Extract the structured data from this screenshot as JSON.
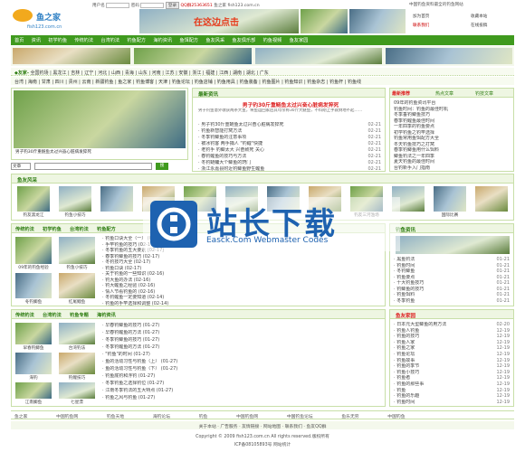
{
  "top": {
    "site_label": "鱼之家",
    "user_label": "用户名",
    "pass_label": "密码",
    "login_btn": "登录",
    "register": "注册",
    "forgot": "忘记密码",
    "site_url": "鱼之家 fish123.com.cn",
    "qq": "QQ群25363651",
    "slogan": "中国钓鱼资料最全的钓鱼网站",
    "links": [
      "加为首页",
      "收藏本站",
      "联系我们",
      "在线投稿"
    ]
  },
  "logo": {
    "cn": "鱼之家",
    "url": "fish123.com.cn"
  },
  "banner": {
    "text": "在这边点击"
  },
  "nav": {
    "items": [
      "首页",
      "资讯",
      "初学钓鱼",
      "传统钓法",
      "台湾钓法",
      "钓鱼配方",
      "海钓资讯",
      "鱼饵配方",
      "鱼友风采",
      "鱼友俱乐部",
      "钓鱼视频",
      "鱼友家园"
    ]
  },
  "region_rows": [
    {
      "label": "◆友家-",
      "items": [
        "全国钓场",
        "黑龙江",
        "吉林",
        "辽宁",
        "河北",
        "山西",
        "青海",
        "山东",
        "河南",
        "江苏",
        "安徽",
        "浙江",
        "福建",
        "江西",
        "湖南",
        "湖北",
        "广东"
      ]
    },
    {
      "label": "",
      "items": [
        "台湾",
        "海南",
        "甘肃",
        "四川",
        "贵州",
        "云南",
        "新疆钓鱼",
        "鱼之家",
        "钓鱼博客",
        "天津",
        "钓鱼论坛",
        "钓鱼店铺",
        "钓鱼用具",
        "钓鱼装备",
        "钓鱼图片",
        "钓鱼知识",
        "钓鱼杂志",
        "钓鱼杆",
        "钓鱼线"
      ]
    }
  ],
  "slide": {
    "caption": "男子钓30斤重鲢鱼太过兴奋心脏病发猝死",
    "dots": [
      "1",
      "2",
      "3",
      "4",
      "5"
    ]
  },
  "search": {
    "select": "文章",
    "button": "搜"
  },
  "latest": {
    "title": "最新资讯",
    "headline": "男子钓30斤重鲢鱼太过兴奋心脏病发猝死",
    "summary": "男子钓鱼意外收获两条大鱼，将鱼运回家后其母亲称30斤大鲢鱼，不料刚上手就倒地不起……",
    "items": [
      {
        "t": "男子钓30斤重鲢鱼太过兴奋心脏病发猝死",
        "d": "02-21"
      },
      {
        "t": "钓鱼新智能打窝方法",
        "d": "02-21"
      },
      {
        "t": "冬季钓鲫鱼的注意事项",
        "d": "02-21"
      },
      {
        "t": "被冰钓客 两手捕人 \"钓鲤\"快捷",
        "d": "02-21"
      },
      {
        "t": "老钓手 钓鲫太大 兴奋致死 关心",
        "d": "02-21"
      },
      {
        "t": "春钓鲤鱼的技巧与方法",
        "d": "02-21"
      },
      {
        "t": "冬钓鲢鳙大个鲫鱼的窍门",
        "d": "02-21"
      },
      {
        "t": "浙江永嘉县附近钓鲫鱼野生鲤鱼",
        "d": "02-21"
      }
    ]
  },
  "recommend": {
    "tabs": [
      "最新推荐",
      "热点文章",
      "钓技文章"
    ],
    "items": [
      "09年的钓鱼资讯平台",
      "钓鱼时间：钓鱼的最佳时机",
      "冬季垂钓鲫鱼技巧",
      "春季钓鲤鱼最佳时间",
      "一年四季的钓鱼要点",
      "初学钓鱼之钓竿选择",
      "钓鱼常用鱼饵配方大全",
      "冬天钓鱼技巧之打窝",
      "春季钓鲫鱼用什么饵料",
      "鲫鱼钓法之一年四季",
      "夏天钓鱼的最佳时间",
      "台钓新手入门指南"
    ]
  },
  "fish_gallery": {
    "title": "鱼友风采",
    "items": [
      "钓友黑龙江",
      "钓鱼小技巧",
      "",
      "",
      "",
      "大鲫鱼",
      "",
      "安徽黄山",
      "钓友三河渔场",
      "国际比赛",
      "",
      "钓友风采"
    ]
  },
  "section2": {
    "tabs": [
      "传统钓法",
      "初学钓鱼",
      "台湾钓法",
      "钓鱼配方"
    ],
    "pics": [
      "09年的钓鱼经验",
      "钓鱼小技巧",
      "冬钓鲫鱼",
      "红尾鲤鱼"
    ],
    "items": [
      {
        "t": "钓鱼口诀大全（一）",
        "d": "02-17"
      },
      {
        "t": "手竿钓鱼的技巧",
        "d": "02-17"
      },
      {
        "t": "冬季钓鱼的五大要素",
        "d": "02-17"
      },
      {
        "t": "春季钓鲫鱼的技巧",
        "d": "02-17"
      },
      {
        "t": "冬钓技巧大全",
        "d": "02-17"
      },
      {
        "t": "钓鱼口诀",
        "d": "02-17"
      },
      {
        "t": "关于钓鱼的一些知识",
        "d": "02-16"
      },
      {
        "t": "钓大鱼的办法",
        "d": "02-16"
      },
      {
        "t": "钓大鲤鱼之经验",
        "d": "02-16"
      },
      {
        "t": "情人节看钓鱼的",
        "d": "02-16"
      },
      {
        "t": "冬钓鲤鱼一定要知道",
        "d": "02-14"
      },
      {
        "t": "钓鱼的手竿选择和调整",
        "d": "02-14"
      }
    ]
  },
  "section2_right": {
    "title": "钓鱼资讯",
    "items": [
      "黑鱼钓法",
      "钓鱼时间",
      "冬钓鲫鱼",
      "钓鱼要点",
      "十大钓鱼技巧",
      "钓鲫鱼的技巧",
      "钓鱼饵料",
      "冬季钓鱼"
    ],
    "dates": [
      "01-21",
      "01-21",
      "01-21",
      "01-21",
      "01-21",
      "01-21",
      "01-21",
      "01-21"
    ]
  },
  "section3": {
    "tabs": [
      "传统钓法",
      "台湾钓法",
      "钓鱼专题",
      "海钓资讯"
    ],
    "pics": [
      "早春钓鲫鱼",
      "台湾钓法",
      "海钓",
      "钓鲤技巧",
      "江南鲫鱼",
      "七星漂"
    ],
    "items": [
      {
        "t": "早春钓鲫鱼的技巧",
        "d": "01-27"
      },
      {
        "t": "早春钓鲤鱼的方法",
        "d": "01-27"
      },
      {
        "t": "冬季钓鲫鱼的技巧",
        "d": "01-27"
      },
      {
        "t": "冬季钓鲤鱼的方法",
        "d": "01-27"
      },
      {
        "t": "\"钓鱼\"的时间",
        "d": "01-27"
      },
      {
        "t": "鱼的活动习性与钓鱼（上）",
        "d": "01-27"
      },
      {
        "t": "鱼的活动习性与钓鱼（下）",
        "d": "01-27"
      },
      {
        "t": "钓鱼底钓和浮钓",
        "d": "01-27"
      },
      {
        "t": "冬季钓鱼之选择钓位",
        "d": "01-27"
      },
      {
        "t": "江南冬季钓法的五大特点",
        "d": "01-27"
      },
      {
        "t": "钓鱼之风与钓鱼",
        "d": "01-27"
      }
    ]
  },
  "friends": {
    "title": "鱼友家园",
    "items": [
      "日本元大型鲫鱼的用方法",
      "钓鱼人钓鱼",
      "钓鱼的技巧",
      "钓鱼人家",
      "钓鱼之家",
      "钓鱼论坛",
      "钓鱼故事",
      "钓鱼的季节",
      "钓鱼小技巧",
      "钓鱼者",
      "钓鱼的那些事",
      "钓鱼",
      "钓鱼的乐趣",
      "钓鱼时间"
    ],
    "dates": [
      "02-20",
      "12-19",
      "12-19",
      "12-19",
      "12-19",
      "12-19",
      "12-19",
      "12-19",
      "12-19",
      "12-19",
      "12-19",
      "12-19",
      "12-19",
      "12-19"
    ]
  },
  "links_bar": {
    "items": [
      "鱼之家",
      "中国钓鱼网",
      "钓鱼天地",
      "海钓论坛",
      "钓鱼",
      "中国钓鱼网",
      "中国钓鱼论坛",
      "鱼乐无穷",
      "中国钓鱼"
    ]
  },
  "footer": {
    "links": [
      "关于本站",
      "广告服务",
      "友情链接",
      "网站地图",
      "联系我们",
      "鱼友QQ群"
    ],
    "copyright": "Copyright © 2009 fish123.com.cn All rights reserved.版权所有",
    "icp": "ICP备08105893号 网站统计"
  },
  "watermark": {
    "title": "站长下载",
    "sub": "Easck.Com Webmaster Codes"
  }
}
